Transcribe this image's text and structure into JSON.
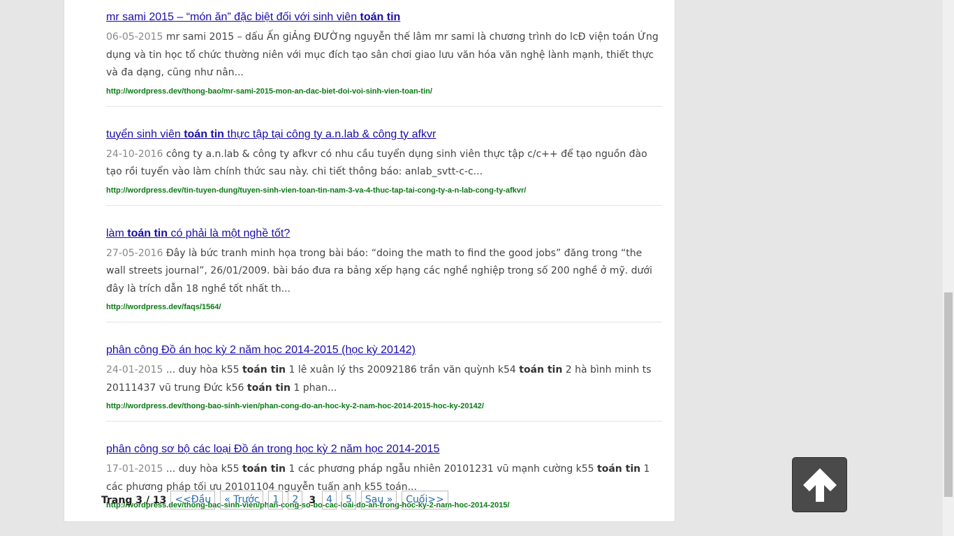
{
  "results": [
    {
      "title_pre": "mr sami 2015 – “món ăn” đặc biệt đối với sinh viên ",
      "title_bold": "toán tin",
      "title_post": "",
      "date": "06-05-2015",
      "snippet": " mr sami 2015 – dấu Ấn giẢng ĐƯỜng nguyễn thế lâm mr sami là chương trình do lcĐ viện toán Ứng dụng và tin học tổ chức thường niên với mục đích tạo sân chơi giao lưu văn hóa văn nghệ lành mạnh, thiết thực và đa dạng, cũng như nân...",
      "url": "http://wordpress.dev/thong-bao/mr-sami-2015-mon-an-dac-biet-doi-voi-sinh-vien-toan-tin/"
    },
    {
      "title_pre": "tuyển sinh viên ",
      "title_bold": "toán tin",
      "title_post": " thực tập tại công ty a.n.lab & công ty afkvr",
      "date": "24-10-2016",
      "snippet": " công ty a.n.lab & công ty afkvr có nhu cầu tuyển dụng sinh viên thực tập c/c++ để tạo nguồn đào tạo rồi tuyển vào làm chính thức sau này. chi tiết thông báo: anlab_svtt-c-c...",
      "url": "http://wordpress.dev/tin-tuyen-dung/tuyen-sinh-vien-toan-tin-nam-3-va-4-thuc-tap-tai-cong-ty-a-n-lab-cong-ty-afkvr/"
    },
    {
      "title_pre": "làm ",
      "title_bold": "toán tin",
      "title_post": " có phải là một nghề tốt?",
      "date": "27-05-2016",
      "snippet": " Đây là bức tranh minh họa trong bài báo: “doing the math to find the good jobs” đăng trong “the wall streets journal”, 26/01/2009. bài báo đưa ra bảng xếp hạng các nghề nghiệp trong số 200 nghề ở mỹ. dưới đây là trích dẫn 18 nghề tốt nhất th...",
      "url": "http://wordpress.dev/faqs/1564/"
    },
    {
      "title_pre": "phân công Đồ án học kỳ 2 năm học 2014-2015 (học kỳ 20142)",
      "title_bold": "",
      "title_post": "",
      "date": "24-01-2015",
      "snippet_parts": [
        " ... duy hòa k55 ",
        "toán tin",
        " 1 lê xuân lý ths 20092186 trần văn quỳnh k54 ",
        "toán tin",
        " 2 hà bình minh ts 20111437 vũ trung Đức k56 ",
        "toán tin",
        " 1 phan..."
      ],
      "url": "http://wordpress.dev/thong-bao-sinh-vien/phan-cong-do-an-hoc-ky-2-nam-hoc-2014-2015-hoc-ky-20142/"
    },
    {
      "title_pre": "phân công sơ bộ các loại Đồ án trong học kỳ 2 năm học 2014-2015",
      "title_bold": "",
      "title_post": "",
      "date": "17-01-2015",
      "snippet_parts": [
        " ... duy hòa k55 ",
        "toán tin",
        " 1 các phương pháp ngẫu nhiên 20101231 vũ mạnh cường k55 ",
        "toán tin",
        " 1 các phương pháp tối ưu 20101104 nguyễn tuấn anh k55 toán..."
      ],
      "url": "http://wordpress.dev/thong-bao-sinh-vien/phan-cong-so-bo-cac-loai-do-an-trong-hoc-ky-2-nam-hoc-2014-2015/"
    }
  ],
  "pagination": {
    "label": "Trang 3 / 13",
    "first": "<<Đầu",
    "prev": "« Trước",
    "p1": "1",
    "p2": "2",
    "current": "3",
    "p4": "4",
    "p5": "5",
    "next": "Sau »",
    "last": "Cuối>>"
  },
  "icons": {
    "back_to_top": "arrow-up-icon"
  },
  "colors": {
    "link": "#1a0dab",
    "url": "#0a7a14",
    "pager_link": "#2a6ba8"
  }
}
